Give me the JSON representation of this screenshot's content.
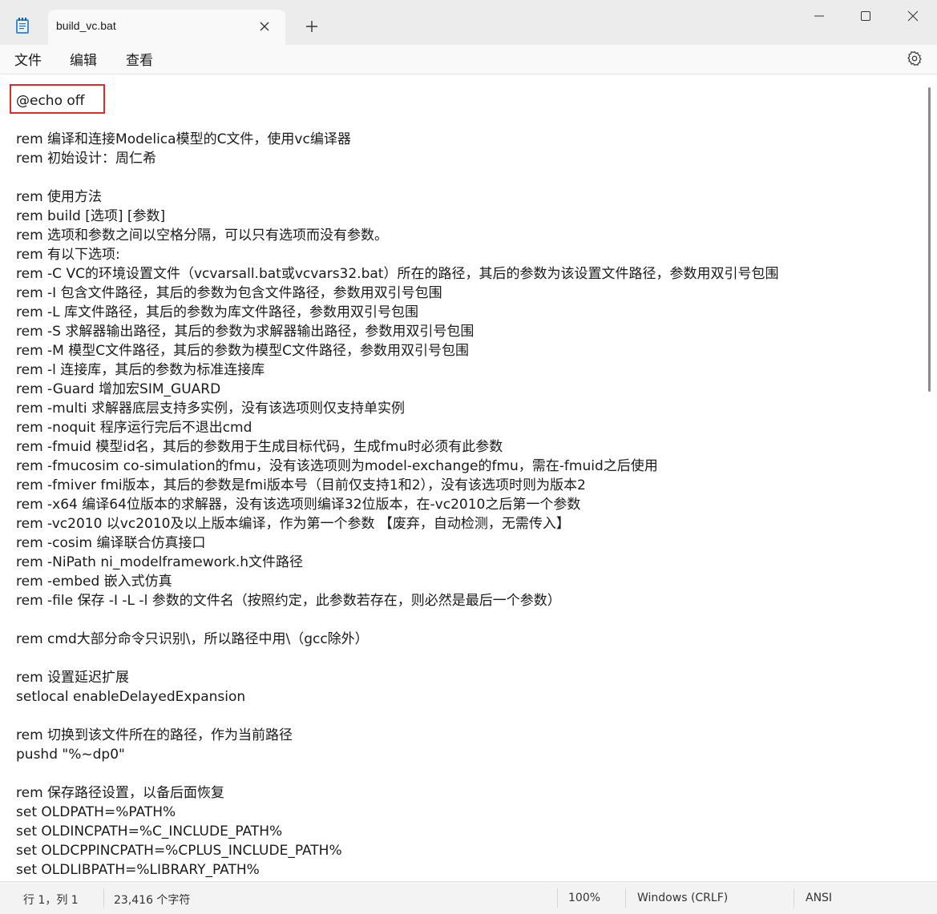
{
  "tab": {
    "title": "build_vc.bat"
  },
  "menu": {
    "file": "文件",
    "edit": "编辑",
    "view": "查看"
  },
  "editor": {
    "lines": [
      "@echo off",
      "",
      "rem 编译和连接Modelica模型的C文件，使用vc编译器",
      "rem 初始设计：周仁希",
      "",
      "rem 使用方法",
      "rem build [选项] [参数]",
      "rem 选项和参数之间以空格分隔，可以只有选项而没有参数。",
      "rem 有以下选项:",
      "rem -C VC的环境设置文件（vcvarsall.bat或vcvars32.bat）所在的路径，其后的参数为该设置文件路径，参数用双引号包围",
      "rem -I 包含文件路径，其后的参数为包含文件路径，参数用双引号包围",
      "rem -L 库文件路径，其后的参数为库文件路径，参数用双引号包围",
      "rem -S 求解器输出路径，其后的参数为求解器输出路径，参数用双引号包围",
      "rem -M 模型C文件路径，其后的参数为模型C文件路径，参数用双引号包围",
      "rem -l 连接库，其后的参数为标准连接库",
      "rem -Guard 增加宏SIM_GUARD",
      "rem -multi 求解器底层支持多实例，没有该选项则仅支持单实例",
      "rem -noquit 程序运行完后不退出cmd",
      "rem -fmuid 模型id名，其后的参数用于生成目标代码，生成fmu时必须有此参数",
      "rem -fmucosim co-simulation的fmu，没有该选项则为model-exchange的fmu，需在-fmuid之后使用",
      "rem -fmiver fmi版本，其后的参数是fmi版本号（目前仅支持1和2），没有该选项时则为版本2",
      "rem -x64 编译64位版本的求解器，没有该选项则编译32位版本，在-vc2010之后第一个参数",
      "rem -vc2010 以vc2010及以上版本编译，作为第一个参数 【废弃，自动检测，无需传入】",
      "rem -cosim 编译联合仿真接口",
      "rem -NiPath ni_modelframework.h文件路径",
      "rem -embed 嵌入式仿真",
      "rem -file 保存 -I -L -l 参数的文件名（按照约定，此参数若存在，则必然是最后一个参数）",
      "",
      "rem cmd大部分命令只识别\\，所以路径中用\\（gcc除外）",
      "",
      "rem 设置延迟扩展",
      "setlocal enableDelayedExpansion",
      "",
      "rem 切换到该文件所在的路径，作为当前路径",
      "pushd \"%~dp0\"",
      "",
      "rem 保存路径设置，以备后面恢复",
      "set OLDPATH=%PATH%",
      "set OLDINCPATH=%C_INCLUDE_PATH%",
      "set OLDCPPINCPATH=%CPLUS_INCLUDE_PATH%",
      "set OLDLIBPATH=%LIBRARY_PATH%"
    ]
  },
  "status": {
    "position": "行 1，列 1",
    "chars": "23,416 个字符",
    "zoom": "100%",
    "line_ending": "Windows (CRLF)",
    "encoding": "ANSI"
  },
  "colors": {
    "highlight": "#e02b2b",
    "accent": "#1a73e8"
  }
}
